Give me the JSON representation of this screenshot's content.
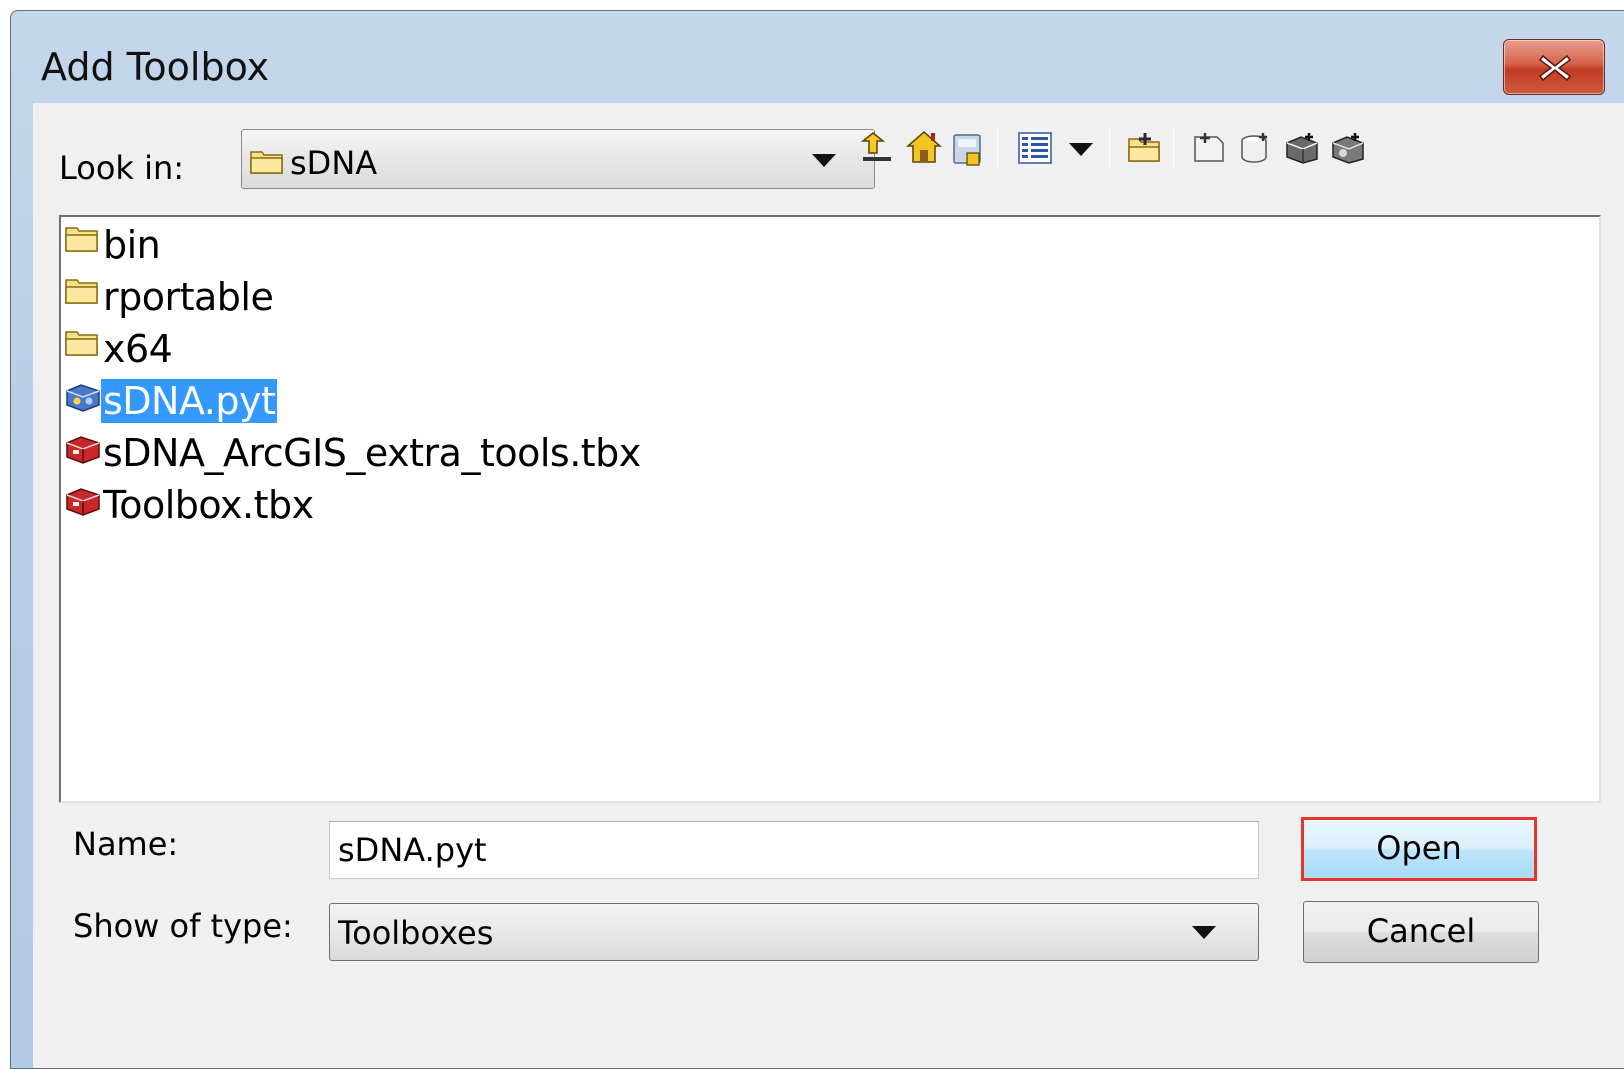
{
  "window": {
    "title": "Add Toolbox",
    "close_icon": "close-icon"
  },
  "lookin": {
    "label": "Look in:",
    "value": "sDNA",
    "icon": "folder-icon"
  },
  "toolbar": {
    "icons": [
      "up-one-level-icon",
      "home-icon",
      "connect-folder-icon",
      "view-list-icon",
      "view-dropdown-icon",
      "new-folder-icon",
      "new-file-icon",
      "new-database-icon",
      "new-toolbox-icon",
      "new-python-toolbox-icon"
    ]
  },
  "files": [
    {
      "name": "bin",
      "icon": "folder-icon",
      "selected": false
    },
    {
      "name": "rportable",
      "icon": "folder-icon",
      "selected": false
    },
    {
      "name": "x64",
      "icon": "folder-icon",
      "selected": false
    },
    {
      "name": "sDNA.pyt",
      "icon": "python-toolbox-icon",
      "selected": true
    },
    {
      "name": "sDNA_ArcGIS_extra_tools.tbx",
      "icon": "toolbox-icon",
      "selected": false
    },
    {
      "name": "Toolbox.tbx",
      "icon": "toolbox-icon",
      "selected": false
    }
  ],
  "name_field": {
    "label": "Name:",
    "value": "sDNA.pyt"
  },
  "type_field": {
    "label": "Show of type:",
    "value": "Toolboxes"
  },
  "buttons": {
    "open": "Open",
    "cancel": "Cancel"
  },
  "colors": {
    "selection": "#3399ff",
    "highlight_box": "#e8322c",
    "close_button": "#c23c24"
  }
}
